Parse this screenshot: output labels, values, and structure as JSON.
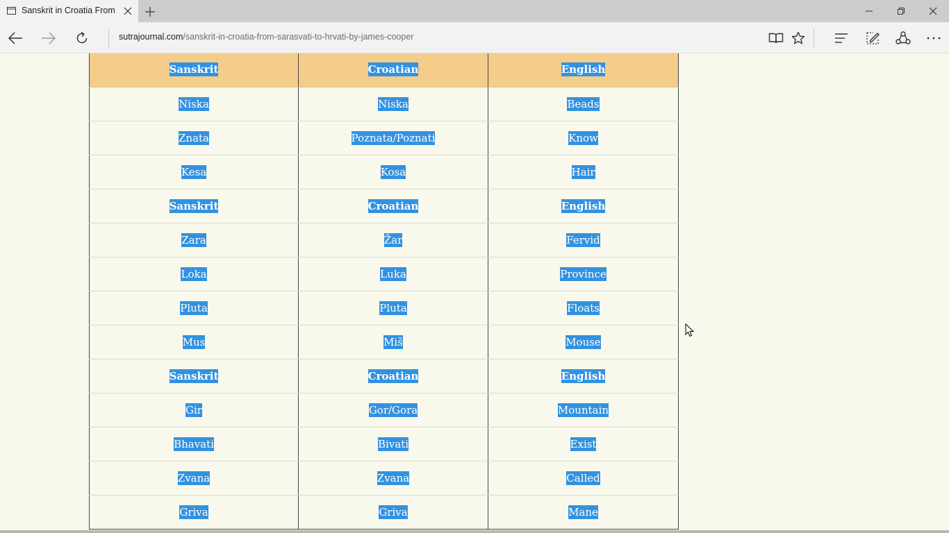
{
  "browser": {
    "tab": {
      "title": "Sanskrit in Croatia From"
    },
    "address": {
      "host": "sutrajournal.com",
      "path": "/sanskrit-in-croatia-from-sarasvati-to-hrvati-by-james-cooper"
    }
  },
  "table": {
    "rows": [
      {
        "kind": "head",
        "cells": [
          "Sanskrit",
          "Croatian",
          "English"
        ]
      },
      {
        "kind": "row",
        "cells": [
          "Niska",
          "Niska",
          "Beads"
        ]
      },
      {
        "kind": "row",
        "cells": [
          "Znata",
          "Poznata/Poznati",
          "Know"
        ]
      },
      {
        "kind": "row",
        "cells": [
          "Kesa",
          "Kosa",
          "Hair"
        ]
      },
      {
        "kind": "subhead",
        "cells": [
          "Sanskrit",
          "Croatian",
          "English"
        ]
      },
      {
        "kind": "row",
        "cells": [
          "Zara",
          "Žar",
          "Fervid"
        ]
      },
      {
        "kind": "row",
        "cells": [
          "Loka",
          "Luka",
          "Province"
        ]
      },
      {
        "kind": "row",
        "cells": [
          "Pluta",
          "Pluta",
          "Floats"
        ]
      },
      {
        "kind": "row",
        "cells": [
          "Mus",
          "Miš",
          "Mouse"
        ]
      },
      {
        "kind": "subhead",
        "cells": [
          "Sanskrit",
          "Croatian",
          "English"
        ]
      },
      {
        "kind": "row",
        "cells": [
          "Gir",
          "Gor/Gora",
          "Mountain"
        ]
      },
      {
        "kind": "row",
        "cells": [
          "Bhavati",
          "Bivati",
          "Exist"
        ]
      },
      {
        "kind": "row",
        "cells": [
          "Zvana",
          "Zvana",
          "Called"
        ]
      },
      {
        "kind": "row",
        "cells": [
          "Griva",
          "Griva",
          "Mane"
        ]
      }
    ]
  },
  "colors": {
    "header_bg": "#f4cd8b",
    "selection": "#3392e0",
    "page_bg": "#f8f9ec"
  }
}
